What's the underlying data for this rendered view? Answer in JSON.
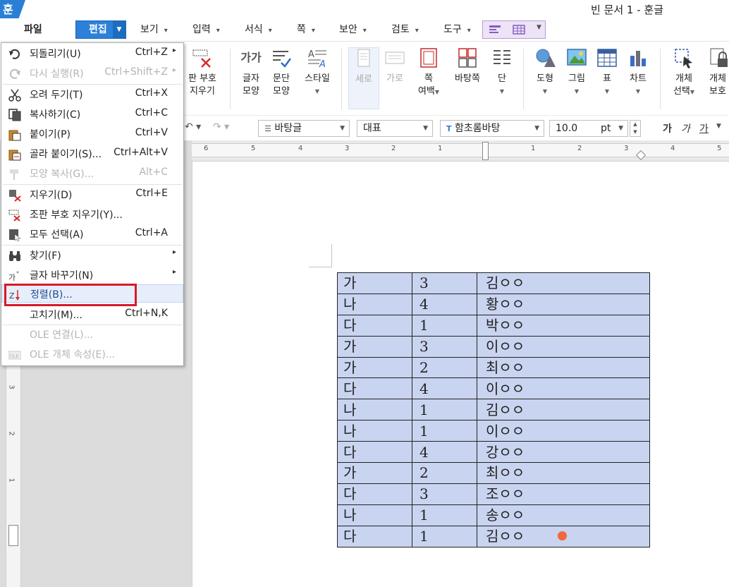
{
  "titlebar": {
    "logo": "훈",
    "title": "빈 문서 1 - 훈글"
  },
  "menubar": {
    "items": [
      {
        "label": "파일"
      },
      {
        "label": "편집"
      },
      {
        "label": "보기"
      },
      {
        "label": "입력"
      },
      {
        "label": "서식"
      },
      {
        "label": "쪽"
      },
      {
        "label": "보안"
      },
      {
        "label": "검토"
      },
      {
        "label": "도구"
      }
    ]
  },
  "ribbon": {
    "clear_markers": {
      "line1": "판 부호",
      "line2": "지우기"
    },
    "char_shape": {
      "line1": "글자",
      "line2": "모양",
      "icon_text": "가가"
    },
    "para_shape": {
      "line1": "문단",
      "line2": "모양"
    },
    "style": {
      "line1": "스타일"
    },
    "vertical": {
      "line1": "세로"
    },
    "horizontal": {
      "line1": "가로"
    },
    "page_margin": {
      "line1": "쪽",
      "line2": "여백"
    },
    "master_page": {
      "line1": "바탕쪽"
    },
    "column": {
      "line1": "단"
    },
    "shape": {
      "line1": "도형"
    },
    "picture": {
      "line1": "그림"
    },
    "table": {
      "line1": "표"
    },
    "chart": {
      "line1": "차트"
    },
    "object_select": {
      "line1": "개체",
      "line2": "선택"
    },
    "object_protect": {
      "line1": "개체",
      "line2": "보호"
    }
  },
  "format_bar": {
    "style_value": "바탕글",
    "lang_value": "대표",
    "font_value": "함초롬바탕",
    "size_value": "10.0",
    "size_unit": "pt",
    "bold_label": "가",
    "italic_label": "가",
    "underline_label": "가"
  },
  "ruler": {
    "h_numbers": [
      "6",
      "5",
      "4",
      "3",
      "2",
      "1",
      "1",
      "2",
      "3",
      "4",
      "5"
    ],
    "v_numbers": [
      "3",
      "2",
      "1"
    ]
  },
  "edit_menu": {
    "items": [
      {
        "label": "되돌리기(U)",
        "shortcut": "Ctrl+Z"
      },
      {
        "label": "다시 실행(R)",
        "shortcut": "Ctrl+Shift+Z"
      },
      {
        "label": "오려 두기(T)",
        "shortcut": "Ctrl+X"
      },
      {
        "label": "복사하기(C)",
        "shortcut": "Ctrl+C"
      },
      {
        "label": "붙이기(P)",
        "shortcut": "Ctrl+V"
      },
      {
        "label": "골라 붙이기(S)...",
        "shortcut": "Ctrl+Alt+V"
      },
      {
        "label": "모양 복사(G)...",
        "shortcut": "Alt+C"
      },
      {
        "label": "지우기(D)",
        "shortcut": "Ctrl+E"
      },
      {
        "label": "조판 부호 지우기(Y)...",
        "shortcut": ""
      },
      {
        "label": "모두 선택(A)",
        "shortcut": "Ctrl+A"
      },
      {
        "label": "찾기(F)",
        "shortcut": ""
      },
      {
        "label": "글자 바꾸기(N)",
        "shortcut": ""
      },
      {
        "label": "정렬(B)...",
        "shortcut": ""
      },
      {
        "label": "고치기(M)...",
        "shortcut": "Ctrl+N,K"
      },
      {
        "label": "OLE 연결(L)...",
        "shortcut": ""
      },
      {
        "label": "OLE 개체 속성(E)...",
        "shortcut": ""
      }
    ]
  },
  "doc_table": {
    "rows": [
      [
        "가",
        "3",
        "김ㅇㅇ"
      ],
      [
        "나",
        "4",
        "황ㅇㅇ"
      ],
      [
        "다",
        "1",
        "박ㅇㅇ"
      ],
      [
        "가",
        "3",
        "이ㅇㅇ"
      ],
      [
        "가",
        "2",
        "최ㅇㅇ"
      ],
      [
        "다",
        "4",
        "이ㅇㅇ"
      ],
      [
        "나",
        "1",
        "김ㅇㅇ"
      ],
      [
        "나",
        "1",
        "이ㅇㅇ"
      ],
      [
        "다",
        "4",
        "강ㅇㅇ"
      ],
      [
        "가",
        "2",
        "최ㅇㅇ"
      ],
      [
        "다",
        "3",
        "조ㅇㅇ"
      ],
      [
        "나",
        "1",
        "송ㅇㅇ"
      ],
      [
        "다",
        "1",
        "김ㅇㅇ"
      ]
    ]
  },
  "colors": {
    "accent": "#2b80d8",
    "table_fill": "#c9d4f0",
    "highlight": "#d8192a",
    "cursor_dot": "#f0683c"
  }
}
